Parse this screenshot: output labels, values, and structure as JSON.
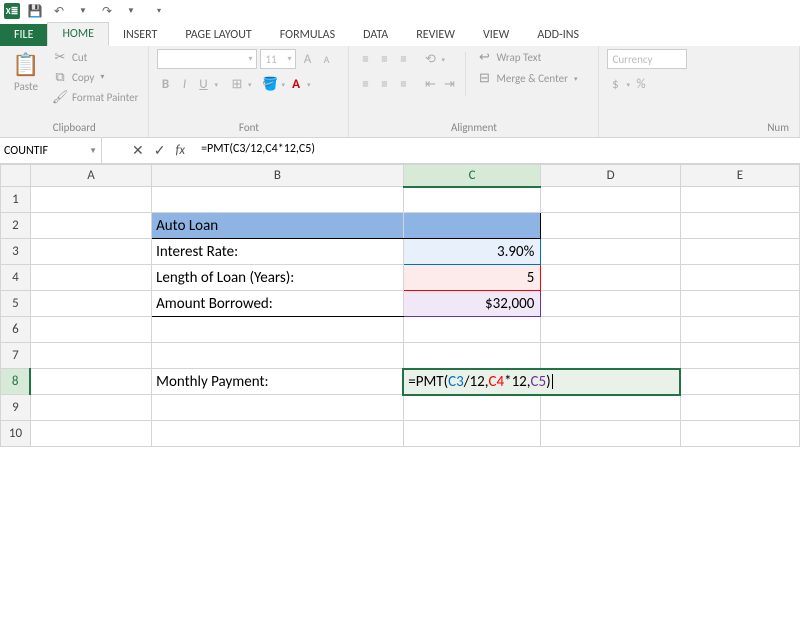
{
  "qat": {
    "save": "💾",
    "undo": "↶",
    "redo": "↷"
  },
  "tabs": {
    "file": "FILE",
    "home": "HOME",
    "insert": "INSERT",
    "pageLayout": "PAGE LAYOUT",
    "formulas": "FORMULAS",
    "data": "DATA",
    "review": "REVIEW",
    "view": "VIEW",
    "addins": "ADD-INS"
  },
  "ribbon": {
    "clipboard": {
      "paste": "Paste",
      "cut": "Cut",
      "copy": "Copy",
      "formatPainter": "Format Painter",
      "label": "Clipboard"
    },
    "font": {
      "sizeVal": "11",
      "label": "Font"
    },
    "alignment": {
      "wrap": "Wrap Text",
      "merge": "Merge & Center",
      "label": "Alignment"
    },
    "number": {
      "format": "Currency",
      "label": "Num"
    }
  },
  "namebox": "COUNTIF",
  "formula": {
    "prefix": "=PMT(",
    "a1": "C3",
    "mid1": "/12,",
    "a2": "C4",
    "mid2": "*12,",
    "a3": "C5",
    "suffix": ")"
  },
  "formulaPlain": "=PMT(C3/12,C4*12,C5)",
  "cols": [
    "A",
    "B",
    "C",
    "D",
    "E"
  ],
  "rows": [
    "1",
    "2",
    "3",
    "4",
    "5",
    "6",
    "7",
    "8",
    "9",
    "10"
  ],
  "cells": {
    "B2": "Auto Loan",
    "B3": "Interest Rate:",
    "C3": "3.90%",
    "B4": "Length of Loan (Years):",
    "C4": "5",
    "B5": "Amount Borrowed:",
    "C5": "$32,000",
    "B8": "Monthly Payment:"
  }
}
